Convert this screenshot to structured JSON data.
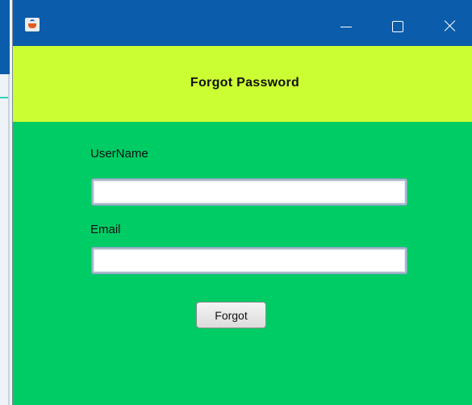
{
  "window": {
    "title": "",
    "app_icon": "java-cup-icon",
    "controls": {
      "minimize_icon": "minimize-icon",
      "maximize_icon": "maximize-icon",
      "close_icon": "close-icon"
    },
    "colors": {
      "titlebar": "#0b5cab",
      "header": "#ccff33",
      "body": "#00cc66"
    }
  },
  "header": {
    "title": "Forgot Password"
  },
  "form": {
    "username_label": "UserName",
    "username_value": "",
    "email_label": "Email",
    "email_value": "",
    "submit_label": "Forgot"
  }
}
